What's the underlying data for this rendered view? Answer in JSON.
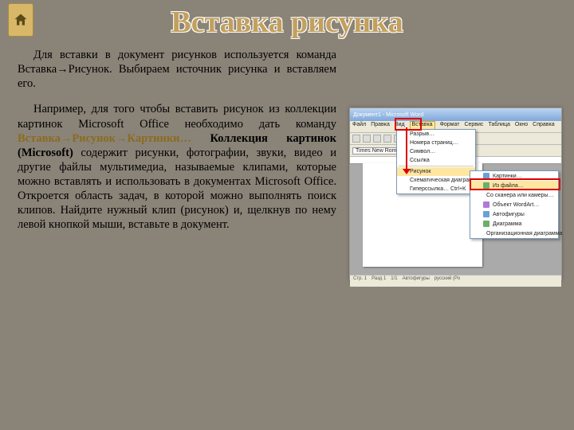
{
  "title": "Вставка рисунка",
  "para1": "Для вставки в документ рисунков используется команда Вставка→Рисунок. Выбираем источник рисунка и вставляем его.",
  "p2a": "Например, для того чтобы вставить рисунок из коллекции картинок Microsoft Office необходимо дать команду ",
  "p2cmd": "Вставка→Рисунок→Картинки…",
  "p2kol": "Коллекция картинок (Microsoft)",
  "p2b": " содержит рисунки, фотографии, звуки, видео и другие файлы мультимедиа, называемые клипами, которые можно вставлять и использовать в документах Microsoft Office. Откроется область задач, в которой можно выполнять поиск клипов. Найдите нужный клип (рисунок) и, щелкнув по нему левой кнопкой мыши, вставьте в документ.",
  "win": {
    "title": "Документ1 - Microsoft Word",
    "menu": [
      "Файл",
      "Правка",
      "Вид",
      "Вставка",
      "Формат",
      "Сервис",
      "Таблица",
      "Окно",
      "Справка"
    ],
    "font": "Times New Roman",
    "menuIdxHL": 3
  },
  "dd1": [
    {
      "t": "Разрыв…"
    },
    {
      "t": "Номера страниц…"
    },
    {
      "t": "Символ…"
    },
    {
      "t": "Ссылка"
    },
    {
      "t": "Рисунок",
      "sel": true
    },
    {
      "t": "Схематическая диаграмма…"
    },
    {
      "t": "Гиперссылка…    Ctrl+K"
    }
  ],
  "dd2": [
    {
      "t": "Картинки…"
    },
    {
      "t": "Из файла…",
      "sel": true
    },
    {
      "t": "Со сканера или камеры…"
    },
    {
      "t": "Объект WordArt…"
    },
    {
      "t": "Автофигуры"
    },
    {
      "t": "Диаграмма"
    },
    {
      "t": "Организационная диаграмма"
    }
  ],
  "status": [
    "Стр. 1",
    "Разд 1",
    "1/1",
    "Автофигуры",
    "русский (Ро"
  ]
}
